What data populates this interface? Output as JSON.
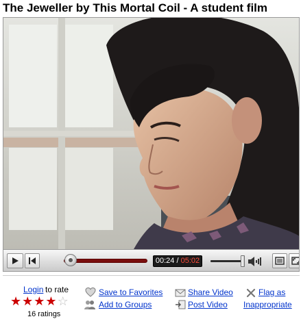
{
  "page": {
    "title": "The Jeweller by This Mortal Coil - A student film"
  },
  "player": {
    "current_time": "00:24",
    "separator": " / ",
    "duration": "05:02",
    "progress_fraction": 0.08,
    "volume_fraction": 0.92,
    "icons": {
      "play": "play-icon",
      "rewind": "skip-back-icon",
      "volume": "volume-icon",
      "fullscreen": "fullscreen-icon"
    }
  },
  "rating": {
    "login_label": "Login",
    "suffix": "to rate",
    "stars_filled": 4,
    "stars_total": 5,
    "count_label": "16 ratings",
    "star_color": "#cc0000"
  },
  "actions": {
    "save_favorites": "Save to Favorites",
    "add_groups": "Add to Groups",
    "share_video": "Share Video",
    "post_video": "Post Video",
    "flag_as": "Flag as",
    "inappropriate": "Inappropriate"
  },
  "colors": {
    "link": "#0033cc",
    "progress": "#cc0000",
    "time_duration": "#ff4b3a"
  }
}
